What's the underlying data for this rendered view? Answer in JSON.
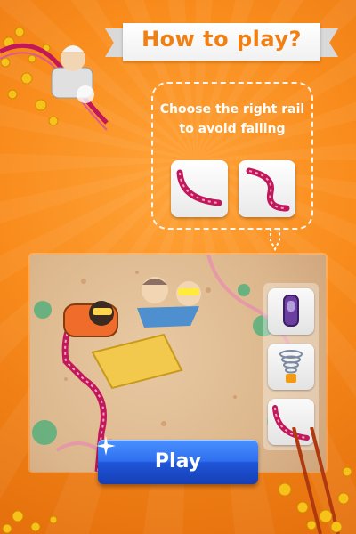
{
  "header": {
    "title": "How to play?"
  },
  "instruction": {
    "hint": "Choose the right rail\nto avoid falling",
    "options": [
      {
        "icon": "curved-rail-down-icon"
      },
      {
        "icon": "curved-rail-s-icon"
      }
    ]
  },
  "scene": {
    "rail_choices": [
      {
        "icon": "purple-block-icon"
      },
      {
        "icon": "spring-icon"
      },
      {
        "icon": "curved-rail-icon"
      }
    ]
  },
  "actions": {
    "play_label": "Play"
  },
  "colors": {
    "background": "#f98c1d",
    "title_text": "#f17f11",
    "rail_pink": "#c2185b",
    "play_blue": "#2f6ff0"
  }
}
